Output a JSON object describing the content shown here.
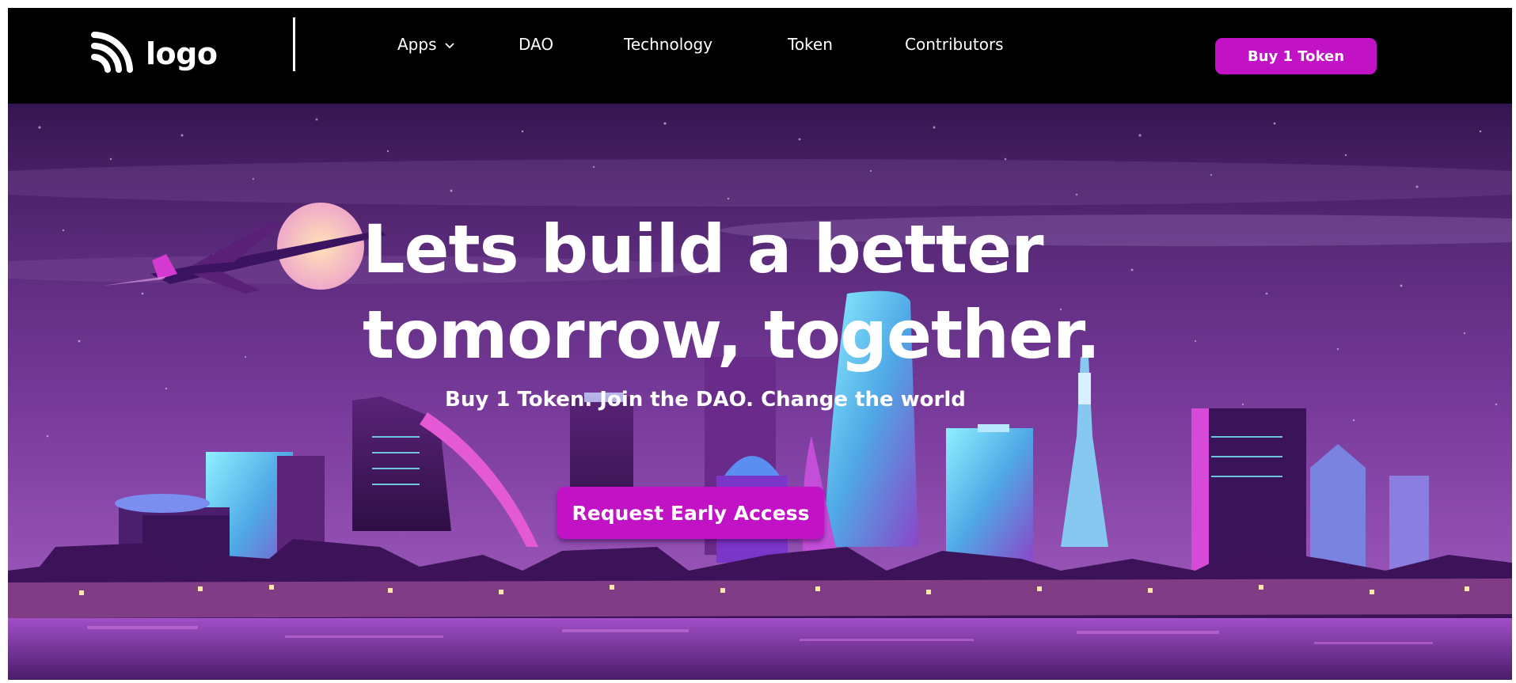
{
  "navbar": {
    "logo_text": "logo",
    "logo_icon": "wifi-signal-icon",
    "items": [
      {
        "label": "Apps",
        "has_dropdown": true
      },
      {
        "label": "DAO"
      },
      {
        "label": "Technology"
      },
      {
        "label": "Token"
      },
      {
        "label": "Contributors"
      }
    ],
    "cta_label": "Buy 1 Token"
  },
  "hero": {
    "title_line1": "Lets build a better",
    "title_line2": "tomorrow, together.",
    "subtitle": "Buy 1 Token. Join the DAO. Change the world",
    "cta_label": "Request Early Access",
    "background": "neon-city-skyline-illustration"
  },
  "colors": {
    "nav_background": "#000000",
    "accent": "#c212c6",
    "sky_top": "#3a1754",
    "sky_bottom": "#8d4cae"
  }
}
